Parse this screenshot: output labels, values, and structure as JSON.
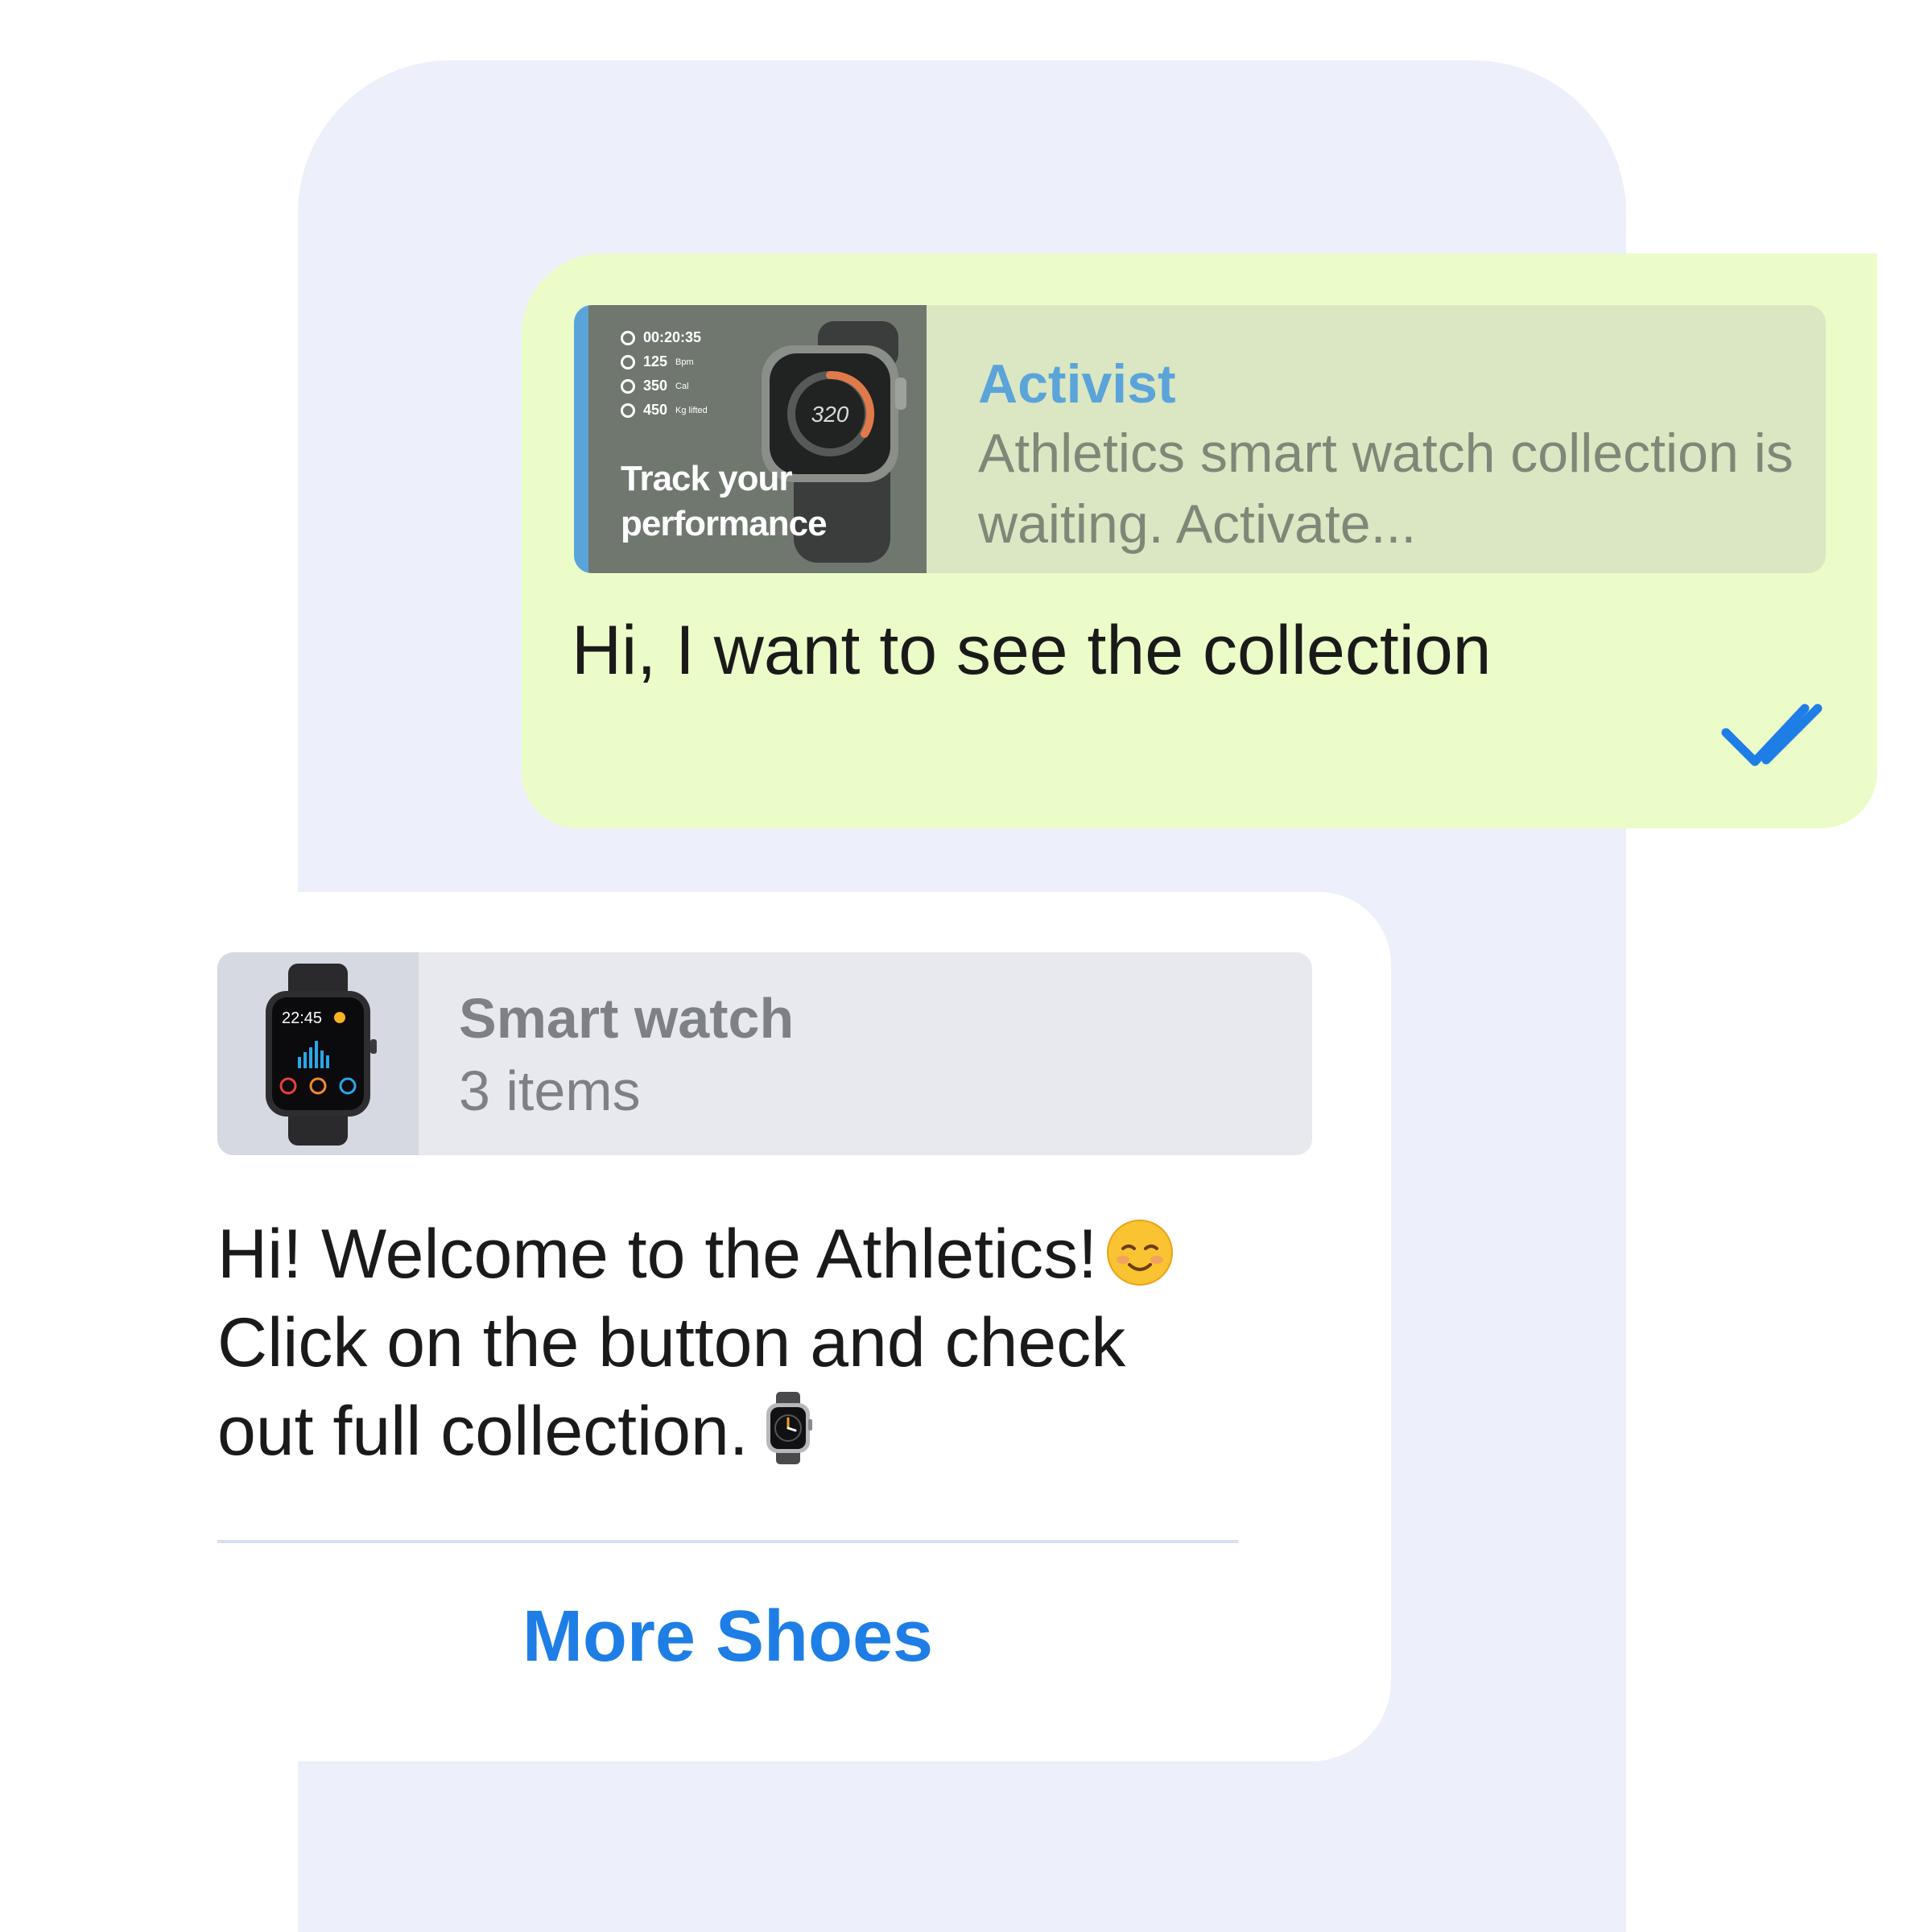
{
  "outgoing": {
    "reply": {
      "title": "Activist",
      "description": "Athletics smart watch collection is waiting. Activate...",
      "thumbnail": {
        "stats": [
          {
            "value": "00:20:35",
            "unit": "",
            "icon": "clock-icon"
          },
          {
            "value": "125",
            "unit": "Bpm",
            "icon": "heart-icon"
          },
          {
            "value": "350",
            "unit": "Cal",
            "icon": "flame-icon"
          },
          {
            "value": "450",
            "unit": "Kg lifted",
            "icon": "weight-icon"
          }
        ],
        "headline_line1": "Track your",
        "headline_line2": "performance",
        "watch_value": "320"
      }
    },
    "text": "Hi, I want to see the collection",
    "status_icon": "double-check-icon",
    "status_color": "#1e7ee6"
  },
  "incoming": {
    "product": {
      "name": "Smart watch",
      "count": "3 items",
      "watch_time": "22:45"
    },
    "text_line1": "Hi! Welcome to the Athletics!",
    "text_line2": "Click on the button and check",
    "text_line3": "out full collection.",
    "emoji1": "smiling-face-emoji",
    "emoji2": "watch-emoji",
    "button_label": "More Shoes",
    "button_color": "#1e7ee6"
  }
}
